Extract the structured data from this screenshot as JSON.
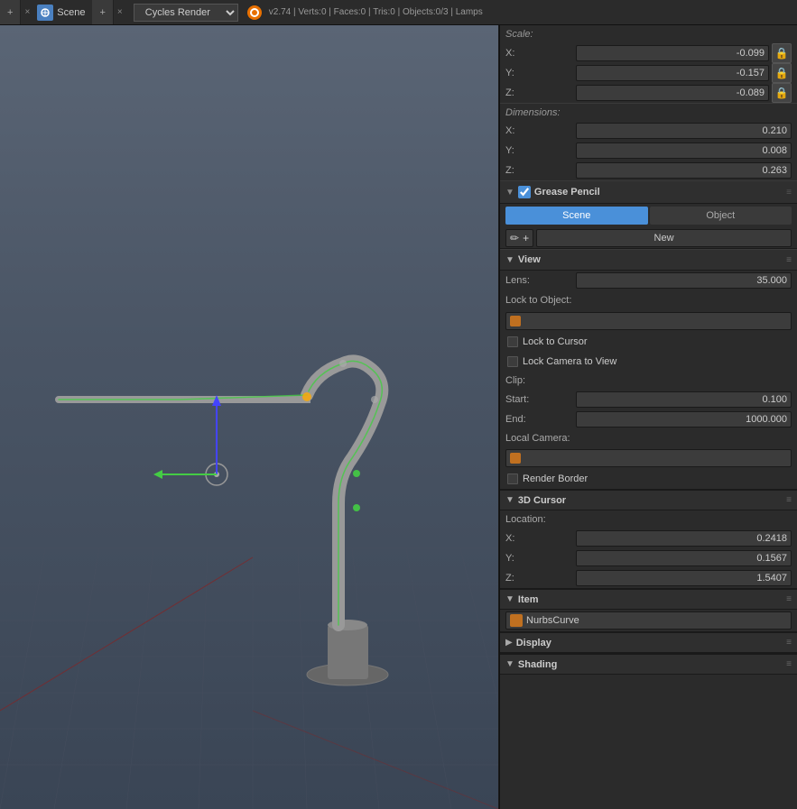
{
  "topbar": {
    "tab1_label": "+",
    "tab1_close": "×",
    "scene_label": "Scene",
    "tab2_label": "+",
    "tab2_close": "×",
    "render_engine": "Cycles Render",
    "info": "v2.74 | Verts:0 | Faces:0 | Tris:0 | Objects:0/3 | Lamps"
  },
  "rightpanel": {
    "scale_section": {
      "title": "Scale:",
      "x_label": "X:",
      "x_value": "-0.099",
      "y_label": "Y:",
      "y_value": "-0.157",
      "z_label": "Z:",
      "z_value": "-0.089"
    },
    "dimensions_section": {
      "title": "Dimensions:",
      "x_label": "X:",
      "x_value": "0.210",
      "y_label": "Y:",
      "y_value": "0.008",
      "z_label": "Z:",
      "z_value": "0.263"
    },
    "grease_pencil": {
      "title": "Grease Pencil",
      "tab_scene": "Scene",
      "tab_object": "Object",
      "new_label": "New",
      "pencil_icon": "✏",
      "plus_icon": "+"
    },
    "view_section": {
      "title": "View",
      "lens_label": "Lens:",
      "lens_value": "35.000",
      "lock_object_label": "Lock to Object:",
      "lock_cursor_label": "Lock to Cursor",
      "lock_camera_label": "Lock Camera to View",
      "clip_label": "Clip:",
      "start_label": "Start:",
      "start_value": "0.100",
      "end_label": "End:",
      "end_value": "1000.000",
      "local_camera_label": "Local Camera:",
      "render_border_label": "Render Border"
    },
    "cursor_3d": {
      "title": "3D Cursor",
      "location_label": "Location:",
      "x_label": "X:",
      "x_value": "0.2418",
      "y_label": "Y:",
      "y_value": "0.1567",
      "z_label": "Z:",
      "z_value": "1.5407"
    },
    "item_section": {
      "title": "Item",
      "nurbs_value": "NurbsCurve"
    },
    "display_section": {
      "title": "Display"
    },
    "shading_section": {
      "title": "Shading"
    }
  }
}
